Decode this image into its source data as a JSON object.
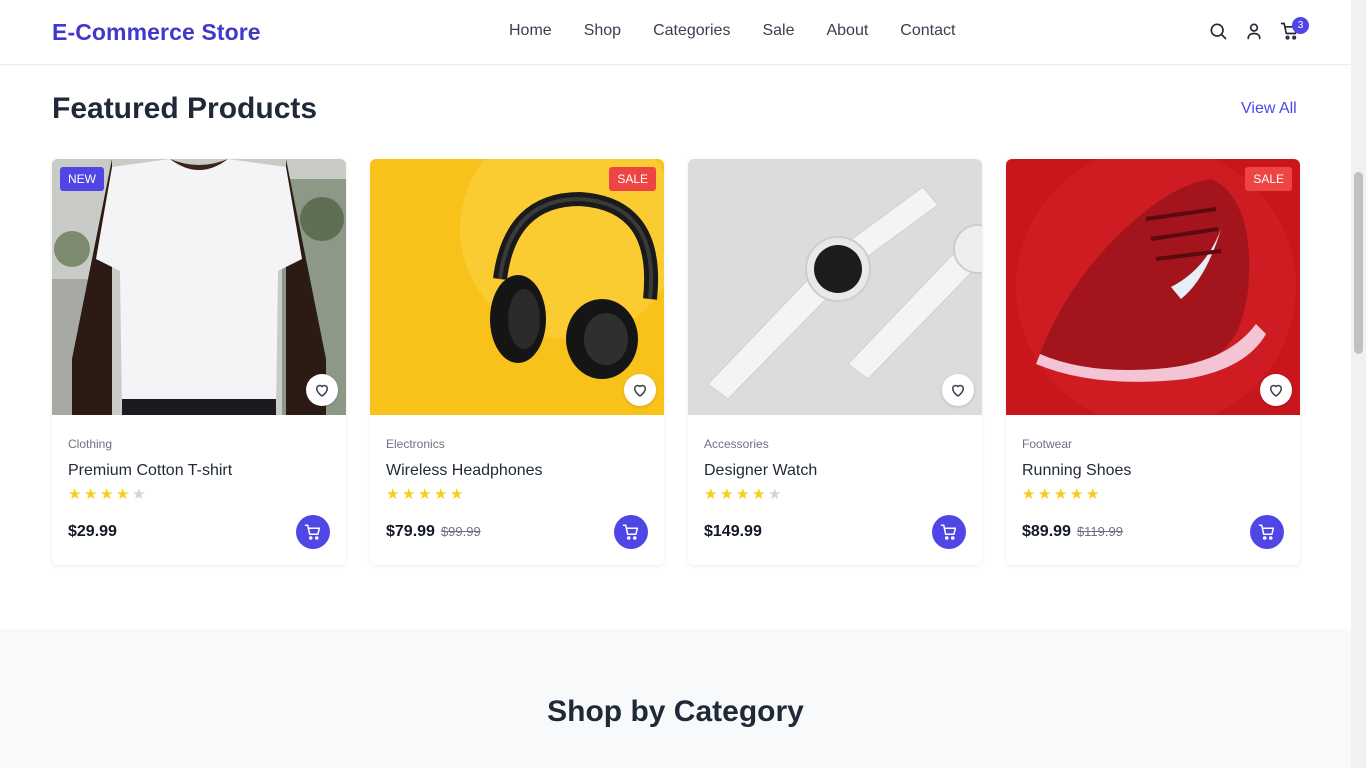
{
  "header": {
    "brand": "E-Commerce Store",
    "nav": [
      "Home",
      "Shop",
      "Categories",
      "Sale",
      "About",
      "Contact"
    ],
    "cart_count": "3",
    "icons": [
      "search-icon",
      "user-icon",
      "cart-icon"
    ]
  },
  "featured": {
    "title": "Featured Products",
    "view_all": "View All",
    "products": [
      {
        "badge": "NEW",
        "category": "Clothing",
        "name": "Premium Cotton T-shirt",
        "rating": 4,
        "price": "$29.99",
        "old_price": ""
      },
      {
        "badge": "SALE",
        "category": "Electronics",
        "name": "Wireless Headphones",
        "rating": 5,
        "price": "$79.99",
        "old_price": "$99.99"
      },
      {
        "badge": "",
        "category": "Accessories",
        "name": "Designer Watch",
        "rating": 4,
        "price": "$149.99",
        "old_price": ""
      },
      {
        "badge": "SALE",
        "category": "Footwear",
        "name": "Running Shoes",
        "rating": 5,
        "price": "$89.99",
        "old_price": "$119.99"
      }
    ]
  },
  "categories_section": {
    "title": "Shop by Category"
  },
  "colors": {
    "accent": "#4f46e5",
    "brand": "#4338ca",
    "sale": "#ef4444",
    "star": "#facc15"
  }
}
